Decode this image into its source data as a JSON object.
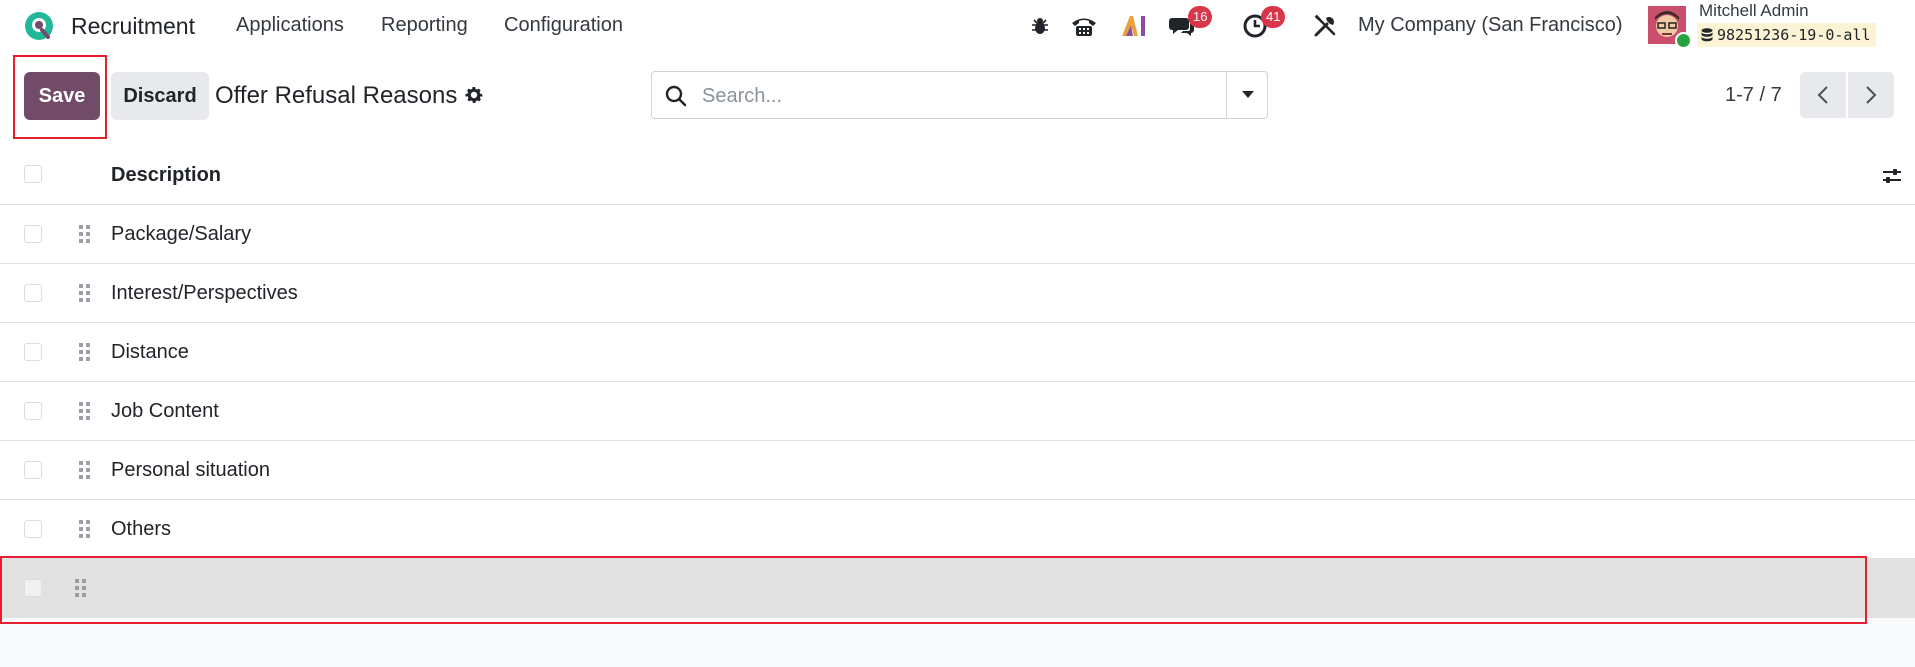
{
  "navbar": {
    "app_name": "Recruitment",
    "menus": [
      "Applications",
      "Reporting",
      "Configuration"
    ],
    "messages_count": "16",
    "activities_count": "41",
    "company": "My Company (San Francisco)",
    "user_name": "Mitchell Admin",
    "database": "98251236-19-0-all"
  },
  "control_panel": {
    "save_label": "Save",
    "discard_label": "Discard",
    "title": "Offer Refusal Reasons",
    "search_placeholder": "Search...",
    "pager": "1-7 / 7"
  },
  "list": {
    "column_description": "Description",
    "rows": [
      "Package/Salary",
      "Interest/Perspectives",
      "Distance",
      "Job Content",
      "Personal situation",
      "Others",
      ""
    ]
  },
  "colors": {
    "brand": "#714b67",
    "highlight": "#e4202e",
    "badge": "#d9364a",
    "selected_row": "#e3e2e3"
  }
}
